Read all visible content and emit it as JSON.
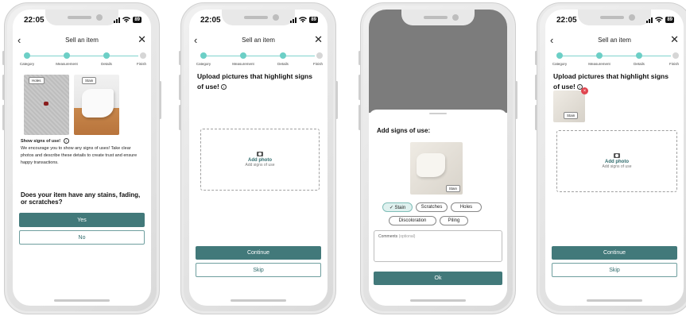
{
  "status": {
    "time": "22:05",
    "battery": "89"
  },
  "nav": {
    "back": "‹",
    "title": "Sell an item",
    "close": "✕"
  },
  "steps": [
    "Category",
    "Measurement",
    "Details",
    "Finish"
  ],
  "screen1": {
    "photo_tags": [
      "Holes",
      "Stain"
    ],
    "heading": "Show signs of use!",
    "info_icon": "info-icon",
    "body": "We encourage you to show any signs of uses! Take clear photos and describe these details to create trust and ensure happy transactions.",
    "question": "Does your item have any stains, fading, or scratches?",
    "yes_label": "Yes",
    "no_label": "No"
  },
  "screen2": {
    "title": "Upload pictures that highlight signs of use!",
    "add_photo": "Add photo",
    "add_sub": "Add signs of use",
    "continue_label": "Continue",
    "skip_label": "Skip"
  },
  "screen3": {
    "title": "Add signs of use:",
    "image_tag": "Stain",
    "chips": [
      {
        "label": "✓ Stain",
        "selected": true
      },
      {
        "label": "Scratches",
        "selected": false
      },
      {
        "label": "Holes",
        "selected": false
      },
      {
        "label": "Discoloration",
        "selected": false
      },
      {
        "label": "Piling",
        "selected": false
      }
    ],
    "comments_label": "Comments",
    "comments_optional": "(optional)",
    "ok_label": "Ok"
  },
  "screen4": {
    "title": "Upload pictures that highlight signs of use!",
    "thumb_tag": "Stain",
    "delete_glyph": "×",
    "add_photo": "Add photo",
    "add_sub": "Add signs of use",
    "continue_label": "Continue",
    "skip_label": "Skip"
  },
  "colors": {
    "primary": "#42797a",
    "accent": "#6ccfc6",
    "delete": "#e0454f"
  }
}
